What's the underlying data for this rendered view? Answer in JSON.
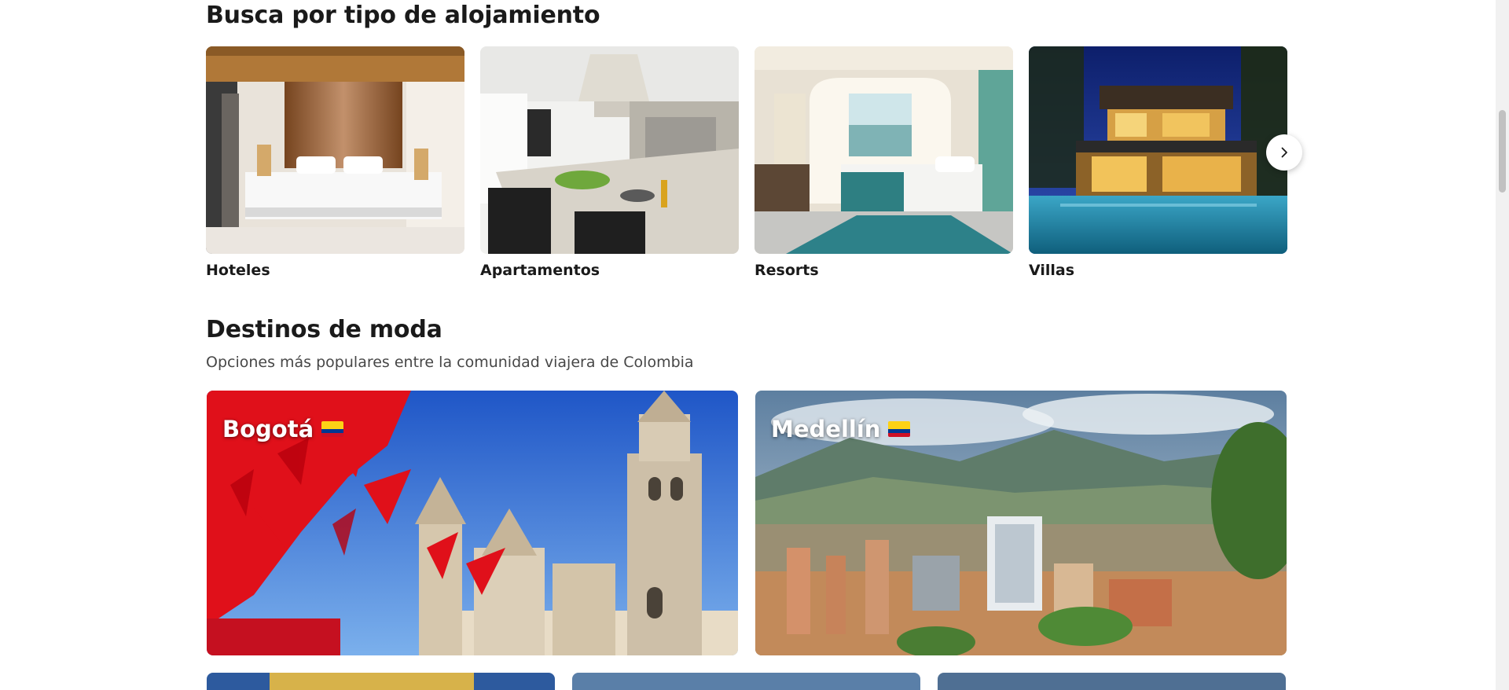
{
  "property_types": {
    "heading": "Busca por tipo de alojamiento",
    "items": [
      {
        "label": "Hoteles"
      },
      {
        "label": "Apartamentos"
      },
      {
        "label": "Resorts"
      },
      {
        "label": "Villas"
      }
    ],
    "next_icon": "chevron-right-icon"
  },
  "trending": {
    "heading": "Destinos de moda",
    "subtitle": "Opciones más populares entre la comunidad viajera de Colombia",
    "destinations": [
      {
        "name": "Bogotá",
        "flag": "colombia-flag-icon"
      },
      {
        "name": "Medellín",
        "flag": "colombia-flag-icon"
      }
    ]
  },
  "colors": {
    "text": "#1a1a1a",
    "subtitle": "#474747",
    "flag_yellow": "#fcd116",
    "flag_blue": "#003893",
    "flag_red": "#ce1126"
  }
}
